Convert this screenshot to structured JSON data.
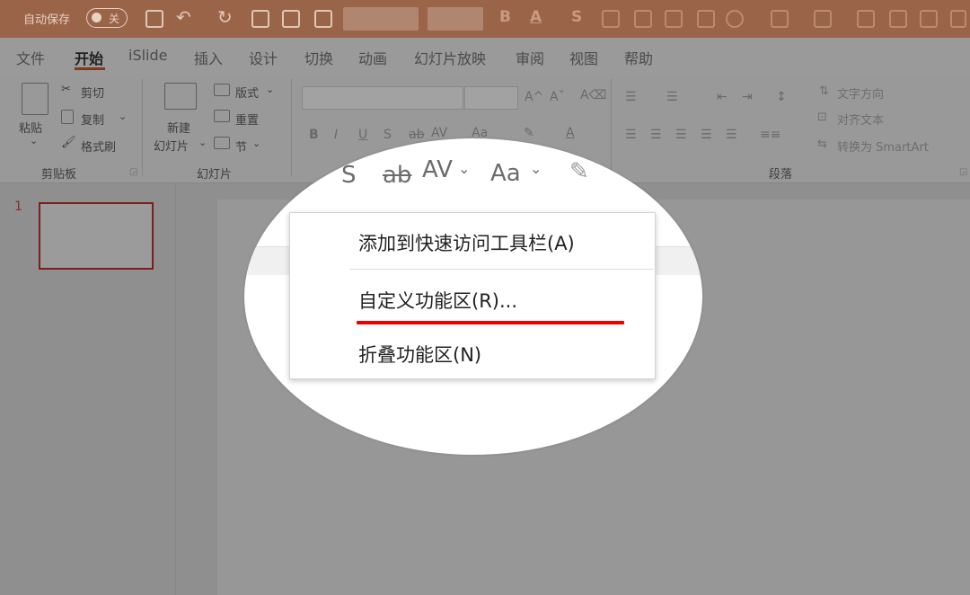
{
  "title_bar": {
    "autosave_label": "自动保存",
    "autosave_state": "关",
    "format_glyphs": [
      "B",
      "A",
      "S"
    ]
  },
  "menu_tabs": [
    "文件",
    "开始",
    "iSlide",
    "插入",
    "设计",
    "切换",
    "动画",
    "幻灯片放映",
    "审阅",
    "视图",
    "帮助"
  ],
  "active_tab": "开始",
  "ribbon": {
    "clipboard": {
      "paste": "粘贴",
      "cut": "剪切",
      "copy": "复制",
      "format_painter": "格式刷",
      "group_label": "剪贴板"
    },
    "slides": {
      "new_slide_line1": "新建",
      "new_slide_line2": "幻灯片",
      "layout": "版式",
      "reset": "重置",
      "section": "节",
      "group_label": "幻灯片"
    },
    "font": {
      "bold": "B",
      "italic": "I",
      "underline": "U",
      "strike": "S"
    },
    "paragraph": {
      "text_direction": "文字方向",
      "align_text": "对齐文本",
      "convert_smartart": "转换为 SmartArt",
      "group_label": "段落"
    }
  },
  "slides_panel": {
    "slide_number": "1"
  },
  "zoom_callout": {
    "strike_glyph": "ab",
    "spacing_glyph": "AV",
    "case_glyph": "Aa",
    "context_menu": {
      "items": [
        "添加到快速访问工具栏(A)",
        "自定义功能区(R)...",
        "折叠功能区(N)"
      ],
      "highlighted_item": "自定义功能区(R)..."
    }
  },
  "colors": {
    "title_bar": "#9a6448",
    "active_tab_underline": "#7c3b1e",
    "highlight_line": "#ee0000",
    "slide_thumb_border": "#7b1e1e"
  }
}
